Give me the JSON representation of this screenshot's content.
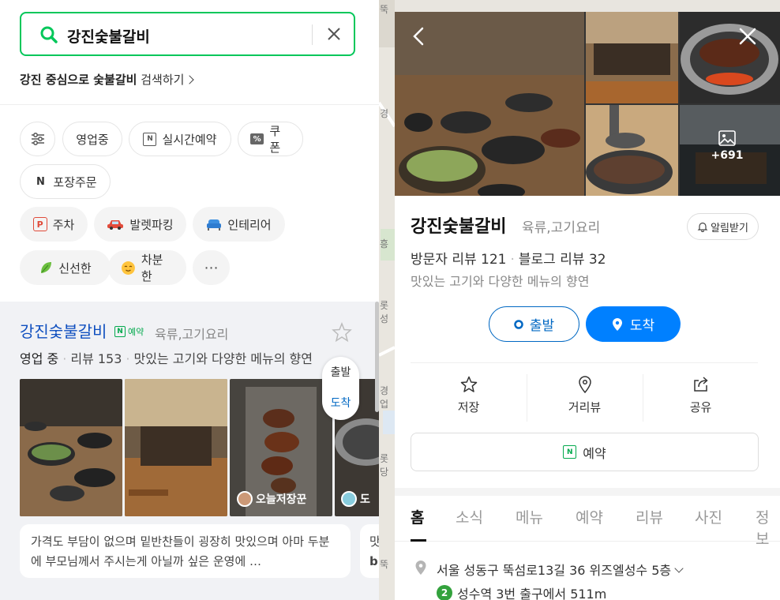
{
  "search": {
    "query": "강진숯불갈비"
  },
  "suggest": {
    "place": "강진 중심으로 숯불갈비",
    "action": "검색하기"
  },
  "filters": [
    {
      "label": "",
      "icon": "filter-settings-icon"
    },
    {
      "label": "영업중",
      "icon": ""
    },
    {
      "label": "실시간예약",
      "icon": "calendar-n-icon"
    },
    {
      "label": "쿠폰",
      "icon": "coupon-icon"
    },
    {
      "label": "포장주문",
      "icon": "naver-n-icon"
    }
  ],
  "themes": [
    {
      "label": "주차",
      "icon": "parking-icon"
    },
    {
      "label": "발렛파킹",
      "icon": "car-icon"
    },
    {
      "label": "인테리어",
      "icon": "sofa-icon"
    },
    {
      "label": "신선한",
      "icon": "leaf-icon"
    },
    {
      "label": "차분한",
      "icon": "calm-face-icon"
    },
    {
      "label": "⋯",
      "icon": "more-icon"
    }
  ],
  "result": {
    "name": "강진숯불갈비",
    "badge": "예약",
    "category": "육류,고기요리",
    "status": "영업 중",
    "reviews": "리뷰 153",
    "desc": "맛있는 고기와 다양한 메뉴의 향연",
    "float_start": "출발",
    "float_end": "도착",
    "tag1": "오늘저장꾼",
    "tag2": "도",
    "review_text": "가격도 부담이 없으며 밑반찬들이 굉장히 맛있으며 아마 두분에 부모님께서 주시는게 아닐까 싶은 운영에 …",
    "review_text2_l1": "맛",
    "review_text2_l2": "b"
  },
  "map_labels": [
    "뚝",
    "경",
    "흥",
    "롯",
    "성",
    "경업",
    "롯당",
    "뚝"
  ],
  "detail": {
    "gallery_more": "+691",
    "name": "강진숯불갈비",
    "category": "육류,고기요리",
    "alarm": "알림받기",
    "visitor_reviews": "방문자 리뷰 121",
    "blog_reviews": "블로그 리뷰 32",
    "desc": "맛있는 고기와 다양한 메뉴의 향연",
    "start": "출발",
    "end": "도착",
    "actions": [
      "저장",
      "거리뷰",
      "공유"
    ],
    "book": "예약",
    "tabs": [
      "홈",
      "소식",
      "메뉴",
      "예약",
      "리뷰",
      "사진",
      "정보"
    ],
    "address": "서울 성동구 뚝섬로13길 36 위즈엘성수 5층",
    "subway_line": "2",
    "subway_text": "성수역 3번 출구에서 511m"
  },
  "colors": {
    "accent_green": "#03c75a",
    "link_blue": "#0f4fbf",
    "primary_blue": "#0080ff"
  }
}
